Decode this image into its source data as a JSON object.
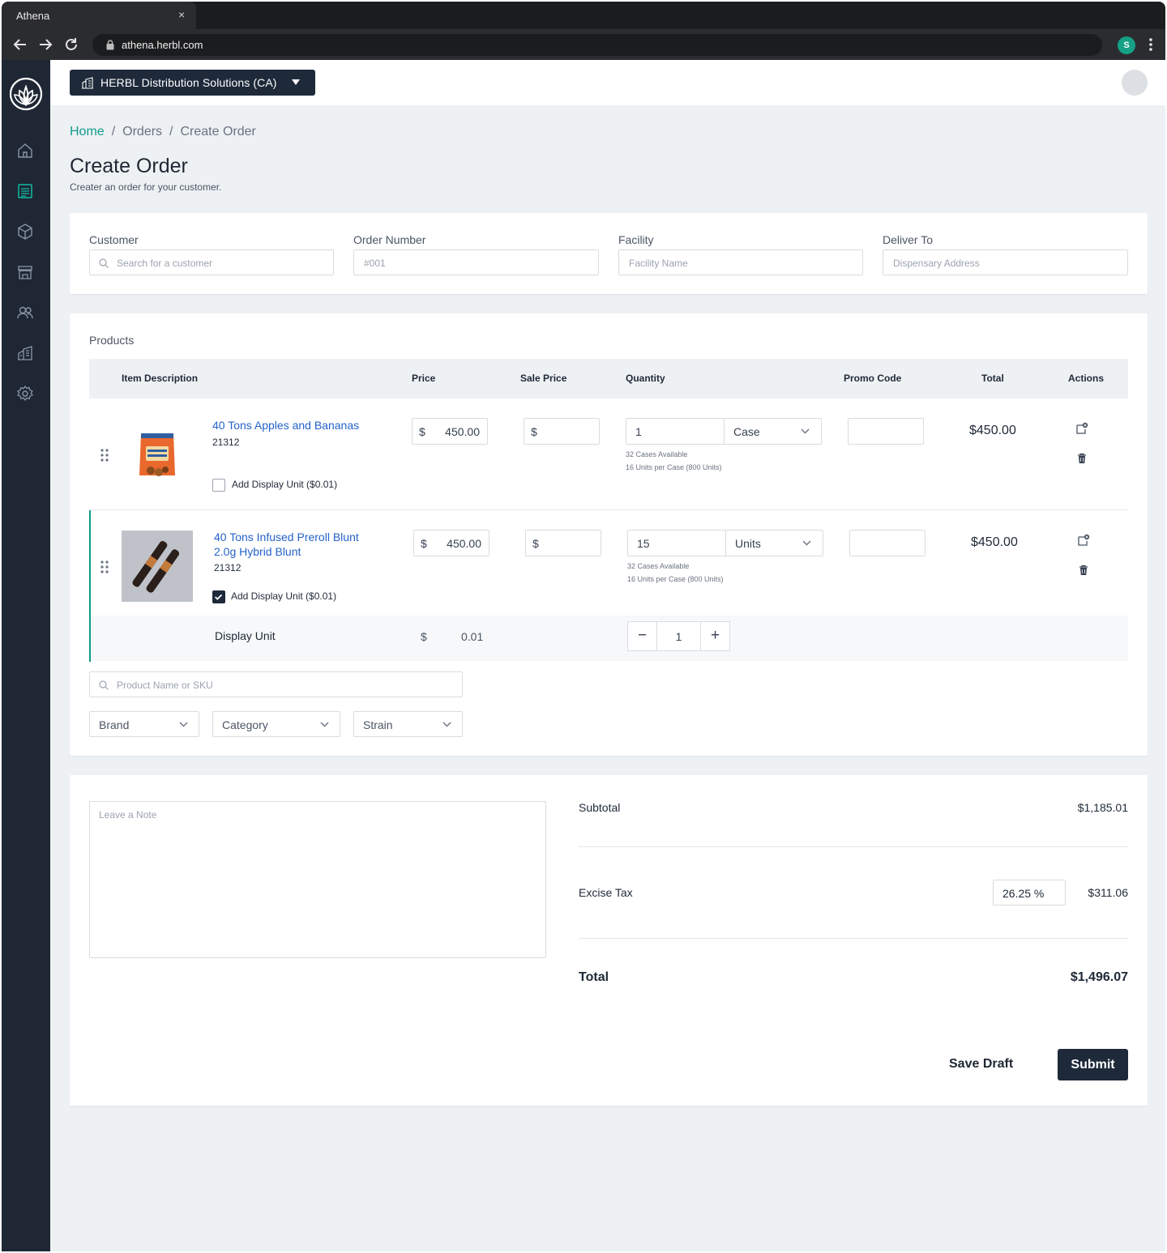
{
  "browser": {
    "tab_title": "Athena",
    "tab_close": "×",
    "url": "athena.herbl.com",
    "profile_initial": "S"
  },
  "topbar": {
    "org_name": "HERBL Distribution Solutions (CA)"
  },
  "sidebar": {
    "items": [
      {
        "icon": "home-icon",
        "active": false
      },
      {
        "icon": "orders-icon",
        "active": true
      },
      {
        "icon": "box-icon",
        "active": false
      },
      {
        "icon": "store-icon",
        "active": false
      },
      {
        "icon": "users-icon",
        "active": false
      },
      {
        "icon": "building-icon",
        "active": false
      },
      {
        "icon": "settings-icon",
        "active": false
      }
    ]
  },
  "breadcrumb": {
    "home": "Home",
    "orders": "Orders",
    "current": "Create Order",
    "separator": "/"
  },
  "header": {
    "title": "Create Order",
    "subtitle": "Creater an order for your customer."
  },
  "order_fields": {
    "customer": {
      "label": "Customer",
      "placeholder": "Search for a customer"
    },
    "order_number": {
      "label": "Order Number",
      "placeholder": "#001"
    },
    "facility": {
      "label": "Facility",
      "placeholder": "Facility Name"
    },
    "deliver_to": {
      "label": "Deliver To",
      "placeholder": "Dispensary Address"
    }
  },
  "products": {
    "section_title": "Products",
    "columns": {
      "item_description": "Item Description",
      "price": "Price",
      "sale_price": "Sale Price",
      "quantity": "Quantity",
      "promo_code": "Promo Code",
      "total": "Total",
      "actions": "Actions"
    },
    "currency_symbol": "$",
    "rows": [
      {
        "name": "40 Tons Apples and Bananas",
        "sku": "21312",
        "price": "450.00",
        "sale_price": "",
        "quantity": "1",
        "unit": "Case",
        "cases_available": "32 Cases Available",
        "units_per_case": "16 Units per Case (800 Units)",
        "promo_code": "",
        "total": "$450.00",
        "display_unit_label": "Add Display Unit ($0.01)",
        "display_unit_checked": false
      },
      {
        "name_line1": "40 Tons Infused Preroll Blunt",
        "name_line2": "2.0g Hybrid Blunt",
        "sku": "21312",
        "price": "450.00",
        "sale_price": "",
        "quantity": "15",
        "unit": "Units",
        "cases_available": "32 Cases Available",
        "units_per_case": "16 Units per Case (800 Units)",
        "promo_code": "",
        "total": "$450.00",
        "display_unit_label": "Add Display Unit ($0.01)",
        "display_unit_checked": true
      }
    ],
    "display_unit": {
      "label": "Display Unit",
      "currency": "$",
      "price": "0.01",
      "quantity": "1",
      "minus": "−",
      "plus": "+"
    },
    "search": {
      "placeholder": "Product Name or SKU"
    },
    "filters": {
      "brand": "Brand",
      "category": "Category",
      "strain": "Strain"
    }
  },
  "summary": {
    "note_placeholder": "Leave a Note",
    "subtotal_label": "Subtotal",
    "subtotal_value": "$1,185.01",
    "excise_label": "Excise Tax",
    "excise_rate": "26.25 %",
    "excise_value": "$311.06",
    "total_label": "Total",
    "total_value": "$1,496.07",
    "save_draft": "Save Draft",
    "submit": "Submit"
  },
  "colors": {
    "accent": "#0f9a8a",
    "sidebar_bg": "#1e2733",
    "primary_button": "#1e2a3a",
    "link": "#2563c9",
    "page_bg": "#eef1f4"
  }
}
